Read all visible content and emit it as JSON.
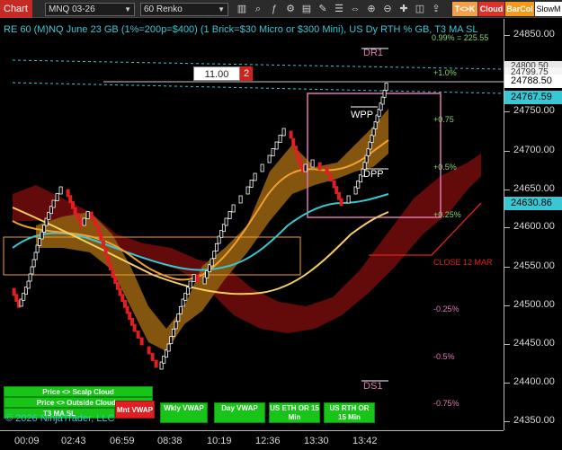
{
  "toolbar": {
    "chart_label": "Chart",
    "instrument": "MNQ 03-26",
    "period": "60 Renko",
    "tk_label": "T<>K",
    "cloud_label": "Cloud",
    "barcol_label": "BarCol",
    "slowm_label": "SlowM"
  },
  "chart": {
    "title": "RE 60 (M)NQ June 23 GB (1%=200p=$400) (1 Brick=$30 Micro or $300 Mini), US Dy RTH % GB, T3 MA SL",
    "order_qty": "11.00",
    "order_count": "2",
    "copyright": "© 2026 NinjaTrader, LLC",
    "close_label": "CLOSE 12 MAR",
    "levels": {
      "dr1": "DR1",
      "ds1": "DS1",
      "wpp": "WPP",
      "dpp": "DPP",
      "p_top": "0.99% = 225.55",
      "p1": "+1.0%",
      "p075": "+0.75",
      "p05": "+0.5%",
      "p025": "+0.25%",
      "m025": "-0.25%",
      "m05": "-0.5%",
      "m075": "-0.75%"
    },
    "buttons": {
      "scalp_cloud": "Price <> Scalp Cloud",
      "outside_clouds": "Price <> Outside Clouds",
      "t3_ma_sl": "T3 MA SL",
      "mnt_vwap": "Mnt VWAP",
      "wkly_vwap": "Wkly VWAP",
      "day_vwap": "Day VWAP",
      "us_eth": "US ETH OR 15 Min",
      "us_rth": "US RTH OR 15 Min"
    }
  },
  "price_axis": {
    "ticks": [
      "24850.00",
      "24750.00",
      "24700.00",
      "24650.00",
      "24600.00",
      "24550.00",
      "24500.00",
      "24450.00",
      "24400.00",
      "24350.00"
    ],
    "badge_top": "24800.50",
    "badge_top2": "24799.75",
    "current_price": "24788.50",
    "badge_cyan": "24767.59",
    "badge_cyan2": "24630.86"
  },
  "time_axis": {
    "labels": [
      "00:09",
      "02:43",
      "06:59",
      "08:38",
      "10:19",
      "12:36",
      "13:30",
      "13:42"
    ]
  },
  "colors": {
    "up_bar": "#ffffff",
    "down_bar": "#e02020",
    "title": "#36c8d4",
    "cyan_line": "#36c8d4",
    "orange_ma": "#f0a030",
    "yellow_ma": "#f5d060",
    "green_btn": "#18c418",
    "red_cloud": "#8a0c0c",
    "orange_cloud": "#8a5a10"
  }
}
